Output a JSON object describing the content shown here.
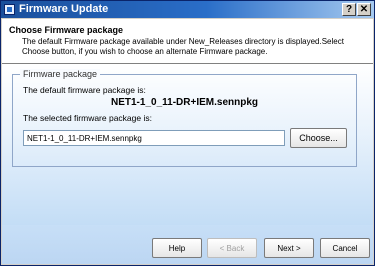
{
  "window": {
    "title": "Firmware Update",
    "help_button": "?",
    "close_button": "✕"
  },
  "header": {
    "title": "Choose Firmware package",
    "description": "The default Firmware package available under New_Releases directory is displayed.Select Choose button, if you wish to choose an alternate Firmware package."
  },
  "group": {
    "legend": "Firmware package",
    "default_label": "The default firmware package is:",
    "default_package": "NET1-1_0_11-DR+IEM.sennpkg",
    "selected_label": "The selected firmware package is:",
    "selected_package": "NET1-1_0_11-DR+IEM.sennpkg",
    "choose_button": "Choose..."
  },
  "footer": {
    "help": "Help",
    "back": "< Back",
    "next": "Next >",
    "cancel": "Cancel"
  },
  "colors": {
    "titlebar_start": "#1a4f9c",
    "titlebar_end": "#a6caf0",
    "content_gradient_end": "#c3ddf6"
  }
}
